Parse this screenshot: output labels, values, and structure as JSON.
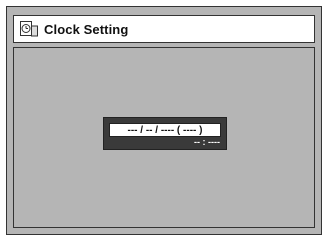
{
  "title": {
    "icon": "clock-setting-icon",
    "text": "Clock Setting"
  },
  "clock_fields": {
    "date": "--- / -- / ---- ( ---- )",
    "time": "-- : ----"
  },
  "colors": {
    "background": "#b5b5b5",
    "title_bar": "#ffffff",
    "field_box": "#3a3a3a",
    "field_highlight": "#ffffff",
    "border": "#333333"
  }
}
